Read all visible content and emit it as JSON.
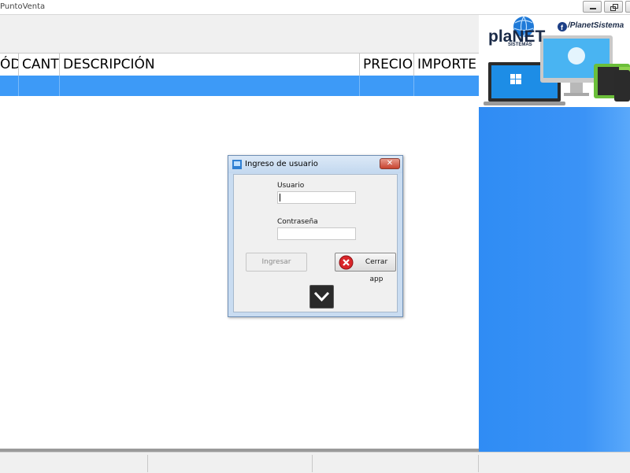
{
  "window": {
    "title": "PuntoVenta"
  },
  "grid": {
    "columns": [
      {
        "label": "ÓD"
      },
      {
        "label": "CANT"
      },
      {
        "label": "DESCRIPCIÓN"
      },
      {
        "label": "PRECIO"
      },
      {
        "label": "IMPORTE"
      }
    ]
  },
  "banner": {
    "brand": "plaNET",
    "brand_sub": "SISTEMAS",
    "social": "/PlanetSistema"
  },
  "dialog": {
    "title": "Ingreso de usuario",
    "close_glyph": "✕",
    "usuario_label": "Usuario",
    "usuario_value": "",
    "password_label": "Contraseña",
    "password_value": "",
    "ingresar_label": "Ingresar",
    "cerrar_label": "Cerrar app"
  },
  "colors": {
    "selection": "#3d9af7",
    "panel": "#2f8cf4"
  }
}
